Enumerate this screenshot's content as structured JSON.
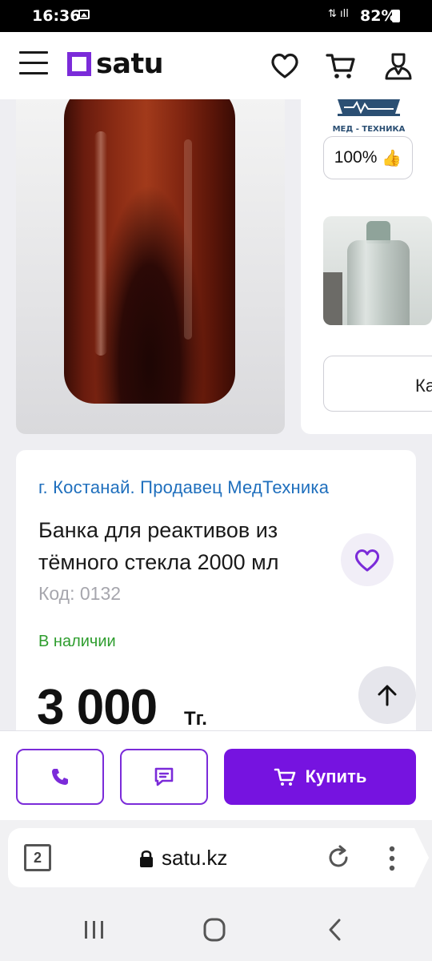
{
  "status_bar": {
    "time": "16:36",
    "network": "⇅ ıll",
    "battery": "82%"
  },
  "header": {
    "logo_text": "satu",
    "brand_color": "#7b2bd9"
  },
  "gallery": {
    "rating": "100%",
    "rating_icon": "thumbs-up-icon",
    "seller_logo_text": "МЕД - ТЕХНИКА",
    "side_button_label": "Ка"
  },
  "product": {
    "seller_line": "г. Костанай. Продавец МедТехника",
    "title": "Банка для реактивов из тёмного стекла 2000 мл",
    "code": "Код: 0132",
    "availability": "В наличии",
    "price": "3 000",
    "currency": "Тг."
  },
  "actions": {
    "call_icon": "phone-icon",
    "message_icon": "message-icon",
    "buy_label": "Купить",
    "accent_color": "#7613e0"
  },
  "browser": {
    "tabs_count": "2",
    "url": "satu.kz"
  }
}
